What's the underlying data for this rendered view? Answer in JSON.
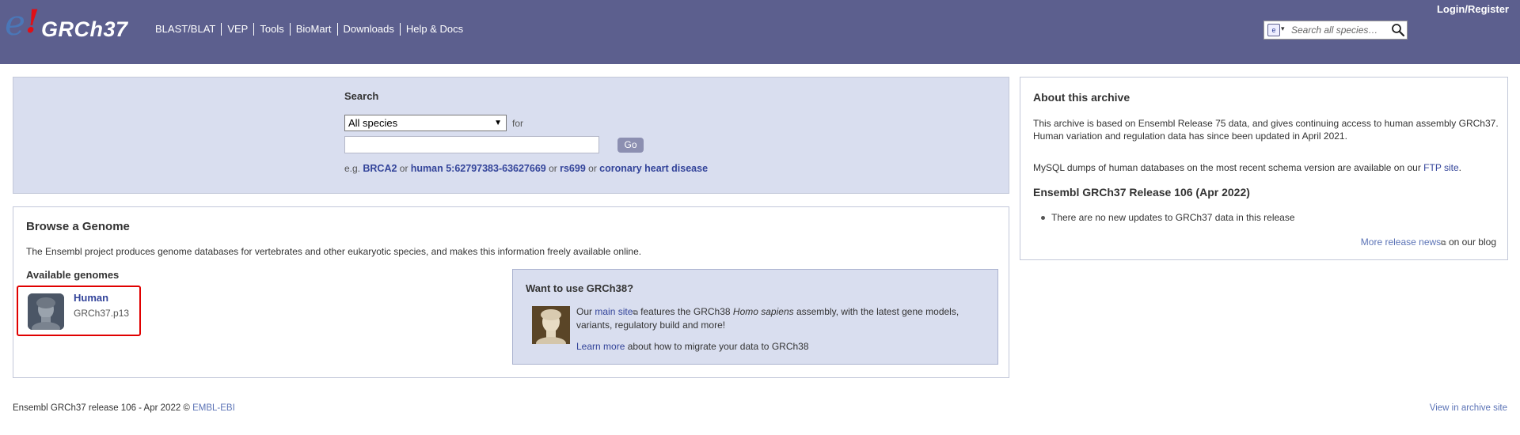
{
  "header": {
    "logo_e": "e",
    "logo_bang": "!",
    "assembly": "GRCh37",
    "nav": [
      "BLAST/BLAT",
      "VEP",
      "Tools",
      "BioMart",
      "Downloads",
      "Help & Docs"
    ],
    "login": "Login/Register",
    "search_placeholder": "Search all species…"
  },
  "search_panel": {
    "title": "Search",
    "species_selected": "All species",
    "for_label": "for",
    "go_label": "Go",
    "eg_prefix": "e.g.",
    "examples": [
      "BRCA2",
      "human 5:62797383-63627669",
      "rs699",
      "coronary heart disease"
    ],
    "or": "or"
  },
  "browse": {
    "title": "Browse a Genome",
    "description": "The Ensembl project produces genome databases for vertebrates and other eukaryotic species, and makes this information freely available online.",
    "available_title": "Available genomes",
    "human_name": "Human",
    "human_assembly": "GRCh37.p13"
  },
  "grch38": {
    "title": "Want to use GRCh38?",
    "our": "Our",
    "main_site": "main site",
    "text_mid": " features the GRCh38 ",
    "species_italic": "Homo sapiens",
    "text_end": " assembly, with the latest gene models, variants, regulatory build and more!",
    "learn_more": "Learn more",
    "learn_more_rest": " about how to migrate your data to GRCh38"
  },
  "about": {
    "title": "About this archive",
    "p1": "This archive is based on Ensembl Release 75 data, and gives continuing access to human assembly GRCh37. Human variation and regulation data has since been updated in April 2021.",
    "p2_prefix": "MySQL dumps of human databases on the most recent schema version are available on our ",
    "ftp_link": "FTP site",
    "p2_suffix": ".",
    "release_title": "Ensembl GRCh37 Release 106 (Apr 2022)",
    "bullet": "There are no new updates to GRCh37 data in this release",
    "more_news": "More release news",
    "on_blog": " on our blog"
  },
  "footer": {
    "left_text": "Ensembl GRCh37 release 106 - Apr 2022 © ",
    "left_link": "EMBL-EBI",
    "right_link": "View in archive site"
  },
  "colors": {
    "masthead": "#5c5f8e",
    "panel_bg": "#d9deef",
    "link": "#33449a",
    "highlight_border": "#e00000"
  }
}
